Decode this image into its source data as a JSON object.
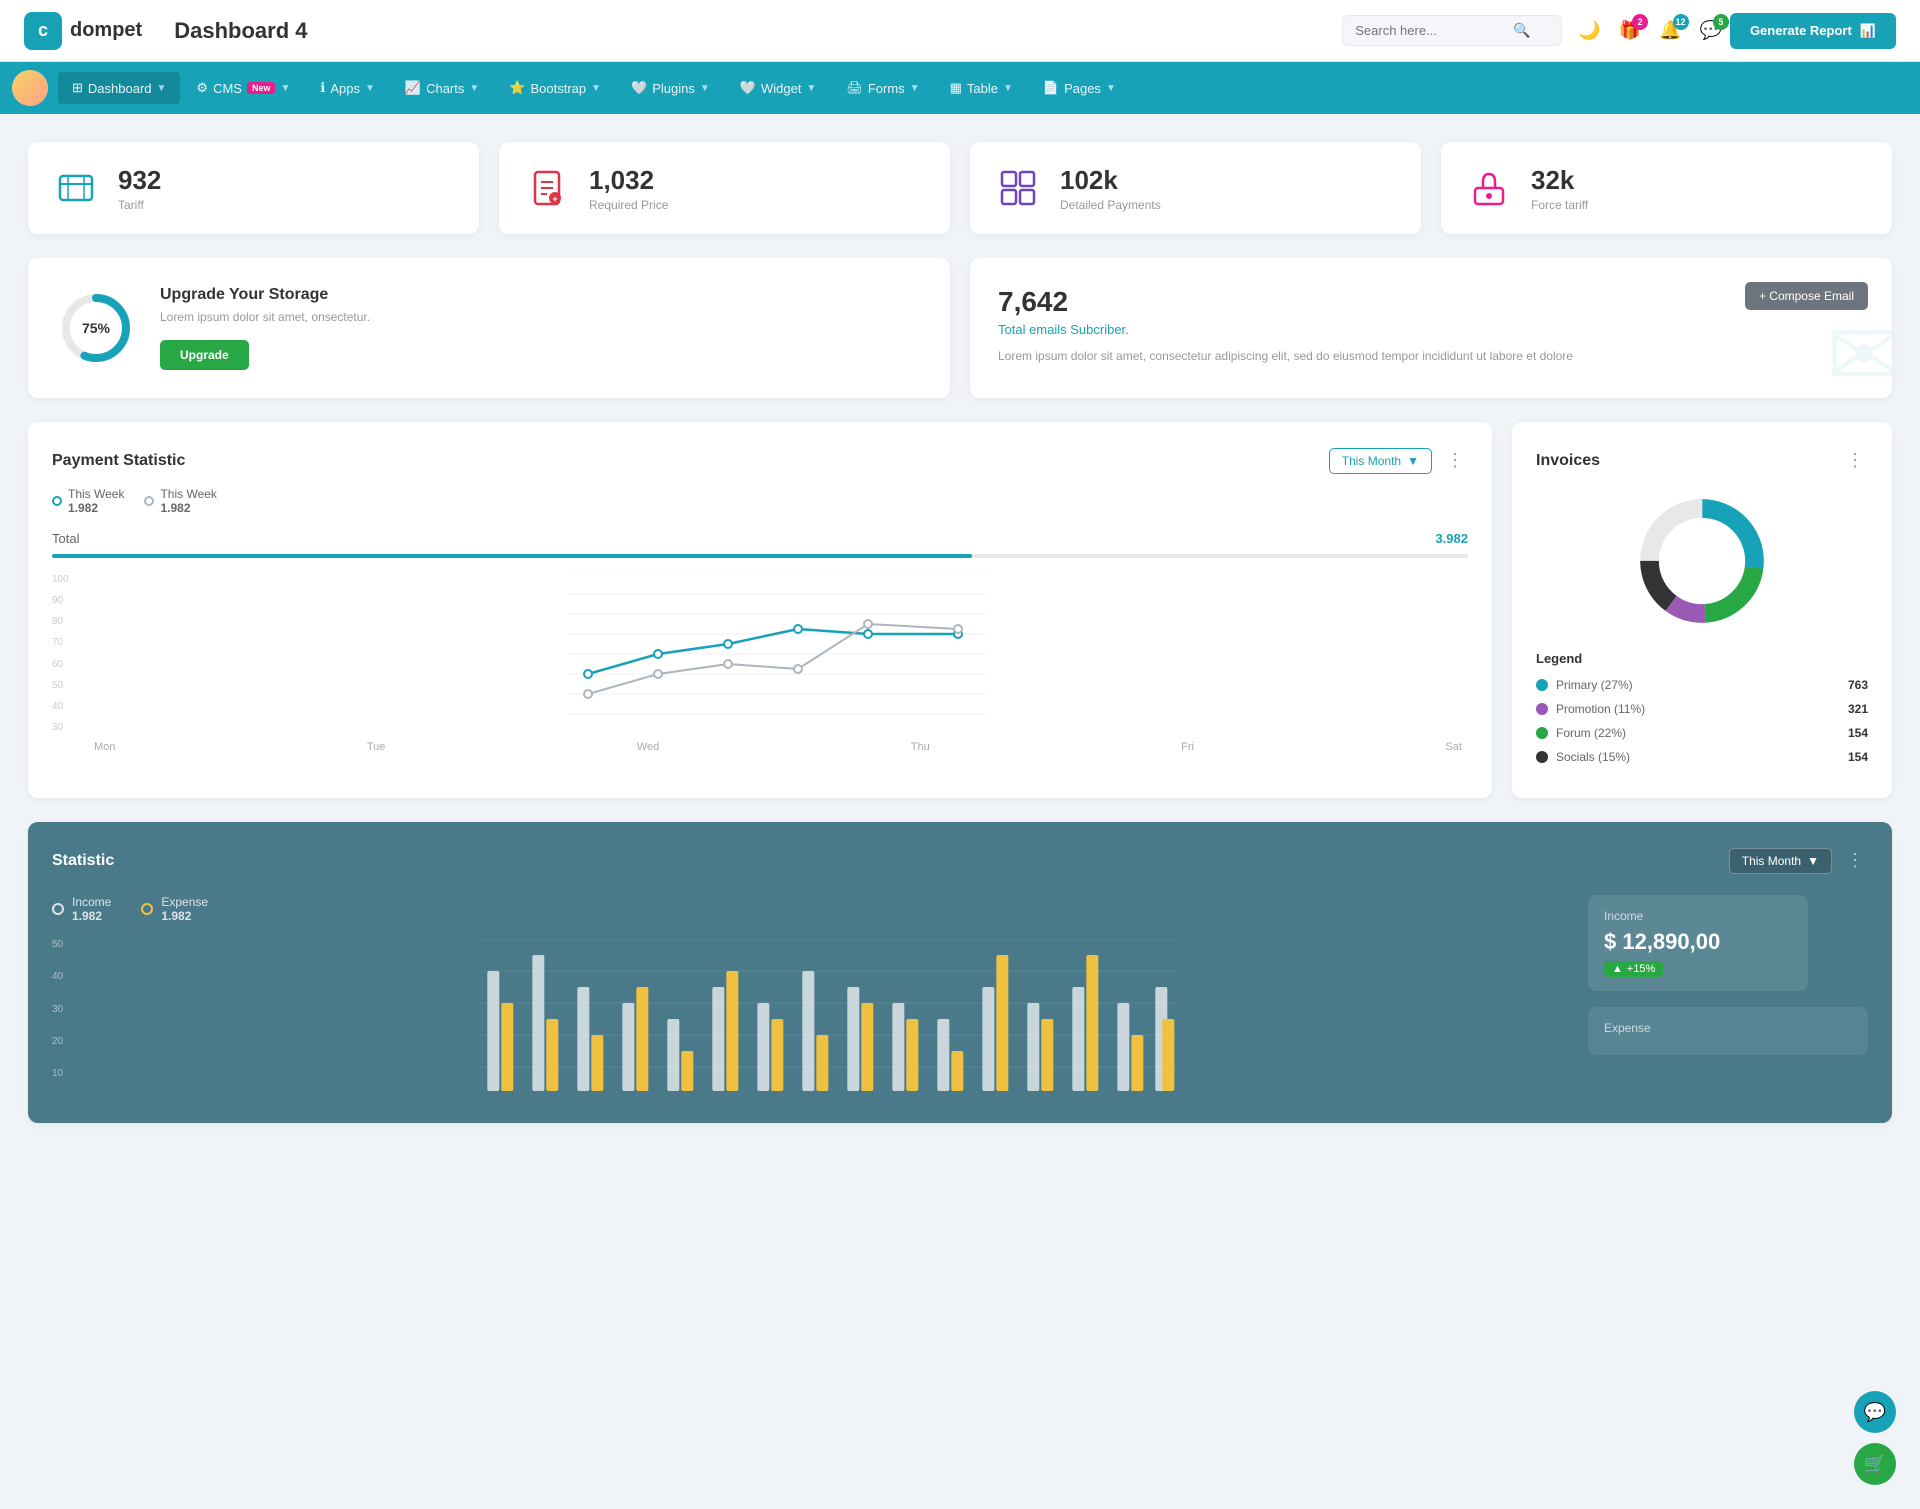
{
  "topbar": {
    "logo_text": "dompet",
    "page_title": "Dashboard 4",
    "search_placeholder": "Search here...",
    "generate_btn": "Generate Report",
    "badges": {
      "gift": "2",
      "bell": "12",
      "chat": "5"
    }
  },
  "navbar": {
    "items": [
      {
        "label": "Dashboard",
        "has_arrow": true,
        "active": true
      },
      {
        "label": "CMS",
        "has_arrow": true,
        "badge_new": true
      },
      {
        "label": "Apps",
        "has_arrow": true
      },
      {
        "label": "Charts",
        "has_arrow": true
      },
      {
        "label": "Bootstrap",
        "has_arrow": true
      },
      {
        "label": "Plugins",
        "has_arrow": true
      },
      {
        "label": "Widget",
        "has_arrow": true
      },
      {
        "label": "Forms",
        "has_arrow": true
      },
      {
        "label": "Table",
        "has_arrow": true
      },
      {
        "label": "Pages",
        "has_arrow": true
      }
    ]
  },
  "stat_cards": [
    {
      "value": "932",
      "label": "Tariff",
      "icon": "🗂️",
      "color": "#17a2b8"
    },
    {
      "value": "1,032",
      "label": "Required Price",
      "icon": "📋",
      "color": "#dc3545"
    },
    {
      "value": "102k",
      "label": "Detailed Payments",
      "icon": "📊",
      "color": "#6f42c1"
    },
    {
      "value": "32k",
      "label": "Force tariff",
      "icon": "💼",
      "color": "#e91e8c"
    }
  ],
  "storage": {
    "percent": "75%",
    "title": "Upgrade Your Storage",
    "desc": "Lorem ipsum dolor sit amet, onsectetur.",
    "btn": "Upgrade"
  },
  "email": {
    "count": "7,642",
    "subtitle": "Total emails Subcriber.",
    "desc": "Lorem ipsum dolor sit amet, consectetur adipiscing elit, sed do eiusmod tempor incididunt ut labore et dolore",
    "compose_btn": "+ Compose Email"
  },
  "payment_chart": {
    "title": "Payment Statistic",
    "this_month": "This Month",
    "legend1_label": "This Week",
    "legend1_value": "1.982",
    "legend2_label": "This Week",
    "legend2_value": "1.982",
    "total_label": "Total",
    "total_value": "3.982",
    "x_labels": [
      "Mon",
      "Tue",
      "Wed",
      "Thu",
      "Fri",
      "Sat"
    ],
    "y_labels": [
      "100",
      "90",
      "80",
      "70",
      "60",
      "50",
      "40",
      "30"
    ],
    "line1_points": "30,140 100,100 170,85 240,80 310,90 380,40",
    "line2_points": "30,120 100,105 170,95 240,100 310,45 380,45"
  },
  "invoices": {
    "title": "Invoices",
    "legend": [
      {
        "label": "Primary (27%)",
        "value": "763",
        "color": "#17a2b8"
      },
      {
        "label": "Promotion (11%)",
        "value": "321",
        "color": "#9b59b6"
      },
      {
        "label": "Forum (22%)",
        "value": "154",
        "color": "#28a745"
      },
      {
        "label": "Socials (15%)",
        "value": "154",
        "color": "#333"
      }
    ],
    "donut": {
      "segments": [
        {
          "percent": 27,
          "color": "#17a2b8"
        },
        {
          "percent": 22,
          "color": "#28a745"
        },
        {
          "percent": 11,
          "color": "#9b59b6"
        },
        {
          "percent": 15,
          "color": "#333"
        },
        {
          "percent": 25,
          "color": "#e8e8e8"
        }
      ]
    }
  },
  "statistic": {
    "title": "Statistic",
    "this_month": "This Month",
    "income_label": "Income",
    "income_value": "1.982",
    "expense_label": "Expense",
    "expense_value": "1.982",
    "income_panel": {
      "title": "Income",
      "value": "$ 12,890,00",
      "badge": "+15%"
    },
    "y_labels": [
      "50",
      "40",
      "30",
      "20",
      "10"
    ],
    "expense_title": "Expense"
  }
}
